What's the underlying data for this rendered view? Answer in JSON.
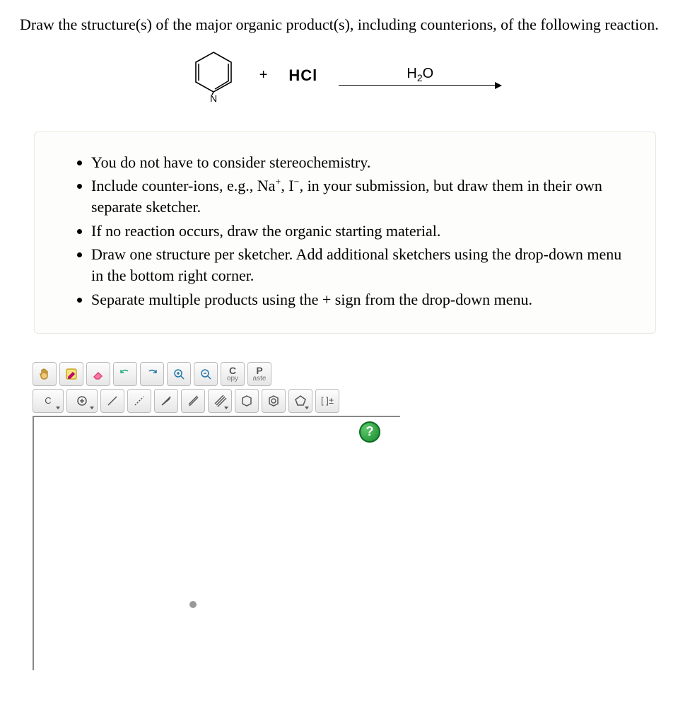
{
  "question": "Draw the structure(s) of the major organic product(s), including counterions, of the following reaction.",
  "reaction": {
    "plus": "+",
    "reagent": "HCl",
    "arrow_label_html": "H<sub>2</sub>O"
  },
  "instructions": [
    "You do not have to consider stereochemistry.",
    "Include counter-ions, e.g., Na<span class='sup'>+</span>, I<span class='sup'>−</span>, in your submission, but draw them in their own separate sketcher.",
    "If no reaction occurs, draw the organic starting material.",
    "Draw one structure per sketcher. Add additional sketchers using the drop-down menu in the bottom right corner.",
    "Separate multiple products using the + sign from the drop-down menu."
  ],
  "toolbar": {
    "row1": [
      {
        "name": "pan-tool",
        "icon": "hand"
      },
      {
        "name": "draw-tool",
        "icon": "pencil-box"
      },
      {
        "name": "erase-tool",
        "icon": "eraser"
      },
      {
        "name": "undo-tool",
        "icon": "undo"
      },
      {
        "name": "redo-tool",
        "icon": "redo"
      },
      {
        "name": "zoom-in-tool",
        "icon": "zoom-in"
      },
      {
        "name": "zoom-out-tool",
        "icon": "zoom-out"
      },
      {
        "name": "copy-tool",
        "big": "C",
        "small": "opy"
      },
      {
        "name": "paste-tool",
        "big": "P",
        "small": "aste"
      }
    ],
    "row2": [
      {
        "name": "element-menu",
        "label": "C",
        "dropdown": true,
        "wide": true
      },
      {
        "name": "add-menu",
        "icon": "plus-circle",
        "dropdown": true,
        "wide": true
      },
      {
        "name": "single-bond",
        "icon": "line"
      },
      {
        "name": "dotted-bond",
        "icon": "dots"
      },
      {
        "name": "wedge-bond",
        "icon": "wedge"
      },
      {
        "name": "double-bond",
        "icon": "double"
      },
      {
        "name": "triple-bond",
        "icon": "triple",
        "dropdown": true
      },
      {
        "name": "cyclohexane",
        "icon": "hex"
      },
      {
        "name": "benzene",
        "icon": "benz"
      },
      {
        "name": "cyclopentane",
        "icon": "pent",
        "dropdown": true
      },
      {
        "name": "charge-tool",
        "label": "[ ]±"
      }
    ]
  },
  "help": "?"
}
